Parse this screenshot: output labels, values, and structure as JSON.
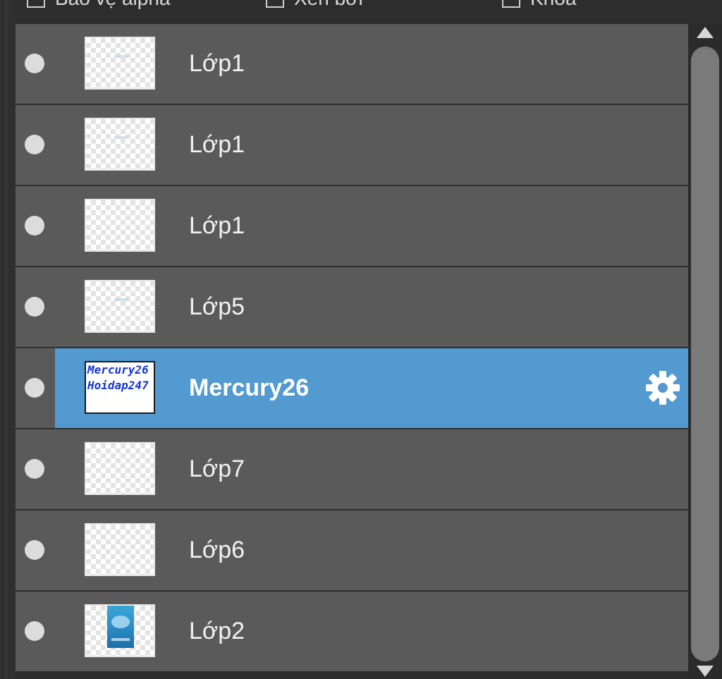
{
  "top_options": [
    {
      "label": "Bảo vệ alpha",
      "checked": false
    },
    {
      "label": "Xén bởi",
      "checked": false
    },
    {
      "label": "Khóa",
      "checked": false
    }
  ],
  "layers": [
    {
      "name": "Lớp1",
      "visible": true,
      "selected": false,
      "thumb": "transparent"
    },
    {
      "name": "Lớp1",
      "visible": true,
      "selected": false,
      "thumb": "transparent"
    },
    {
      "name": "Lớp1",
      "visible": true,
      "selected": false,
      "thumb": "transparent"
    },
    {
      "name": "Lớp5",
      "visible": true,
      "selected": false,
      "thumb": "transparent"
    },
    {
      "name": "Mercury26",
      "visible": true,
      "selected": true,
      "thumb": "text",
      "thumb_text": [
        "Mercury26",
        "Hoidap247"
      ]
    },
    {
      "name": "Lớp7",
      "visible": true,
      "selected": false,
      "thumb": "transparent"
    },
    {
      "name": "Lớp6",
      "visible": true,
      "selected": false,
      "thumb": "transparent"
    },
    {
      "name": "Lớp2",
      "visible": true,
      "selected": false,
      "thumb": "photo"
    }
  ],
  "colors": {
    "row_bg": "#5a5a5a",
    "selected_bg": "#539ad0",
    "panel_bg": "#2b2b2b"
  },
  "icons": {
    "visibility": "eye-dot-icon",
    "settings": "gear-icon",
    "scroll_up": "arrow-up-icon",
    "scroll_down": "arrow-down-icon"
  }
}
